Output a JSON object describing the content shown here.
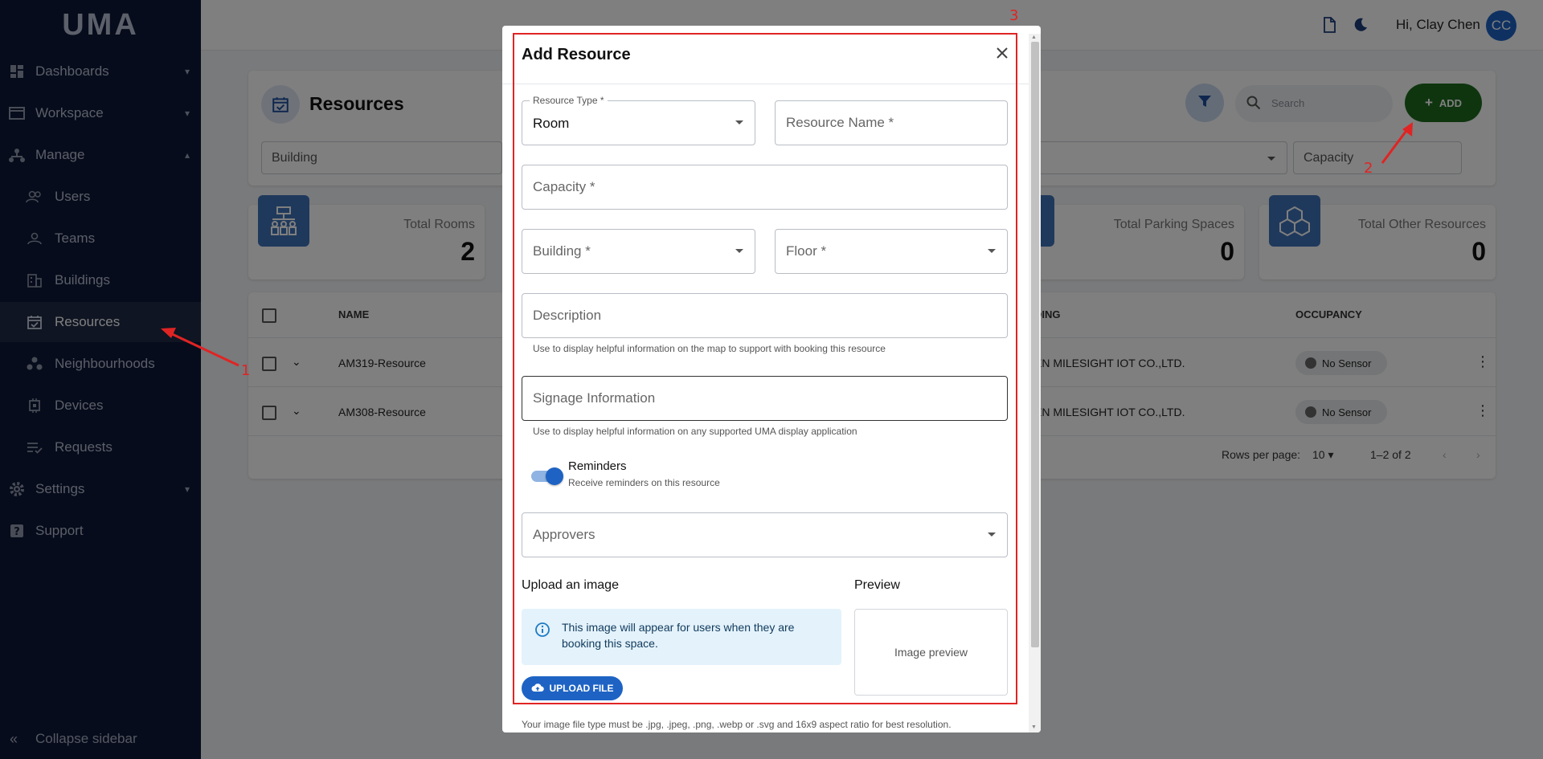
{
  "app": {
    "logo": "UMA"
  },
  "sidebar": {
    "items": [
      {
        "label": "Dashboards",
        "chevron": "⌄"
      },
      {
        "label": "Workspace",
        "chevron": "⌄"
      },
      {
        "label": "Manage",
        "chevron": "⌃"
      },
      {
        "label": "Users"
      },
      {
        "label": "Teams"
      },
      {
        "label": "Buildings"
      },
      {
        "label": "Resources"
      },
      {
        "label": "Neighbourhoods"
      },
      {
        "label": "Devices"
      },
      {
        "label": "Requests"
      },
      {
        "label": "Settings",
        "chevron": "⌄"
      },
      {
        "label": "Support"
      }
    ],
    "collapse_label": "Collapse sidebar"
  },
  "topbar": {
    "greeting": "Hi, Clay Chen",
    "avatar_initials": "CC"
  },
  "page": {
    "title": "Resources",
    "search_placeholder": "Search",
    "add_label": "ADD",
    "filters": {
      "building": "Building",
      "capacity": "Capacity"
    }
  },
  "stats": [
    {
      "title": "Total Rooms",
      "value": "2"
    },
    {
      "title": "Total Parking Spaces",
      "value": "0"
    },
    {
      "title": "Total Other Resources",
      "value": "0"
    }
  ],
  "table": {
    "headers": {
      "name": "NAME",
      "building": "DING",
      "occupancy": "OCCUPANCY"
    },
    "rows": [
      {
        "name": "AM319-Resource",
        "building": "EN MILESIGHT IOT CO.,LTD.",
        "occupancy": "No Sensor"
      },
      {
        "name": "AM308-Resource",
        "building": "EN MILESIGHT IOT CO.,LTD.",
        "occupancy": "No Sensor"
      }
    ],
    "rows_per_page_label": "Rows per page:",
    "rows_per_page": "10",
    "range": "1–2 of 2"
  },
  "modal": {
    "title": "Add Resource",
    "resource_type": {
      "label": "Resource Type *",
      "value": "Room"
    },
    "resource_name_placeholder": "Resource Name *",
    "capacity_placeholder": "Capacity *",
    "building_placeholder": "Building *",
    "floor_placeholder": "Floor *",
    "description_placeholder": "Description",
    "description_helper": "Use to display helpful information on the map to support with booking this resource",
    "signage_placeholder": "Signage Information",
    "signage_helper": "Use to display helpful information on any supported UMA display application",
    "reminders_title": "Reminders",
    "reminders_sub": "Receive reminders on this resource",
    "reminders_on": true,
    "approvers_placeholder": "Approvers",
    "upload_title": "Upload an image",
    "preview_title": "Preview",
    "info_text": "This image will appear for users when they are booking this space.",
    "preview_placeholder": "Image preview",
    "upload_button": "UPLOAD FILE",
    "file_note": "Your image file type must be .jpg, .jpeg, .png, .webp or .svg and 16x9 aspect ratio for best resolution."
  },
  "annotations": {
    "n1": "1",
    "n2": "2",
    "n3": "3"
  },
  "colors": {
    "sidebar": "#0e1838",
    "accent": "#1e63c4",
    "add": "#1e6b1f",
    "annotation": "#e02424"
  }
}
